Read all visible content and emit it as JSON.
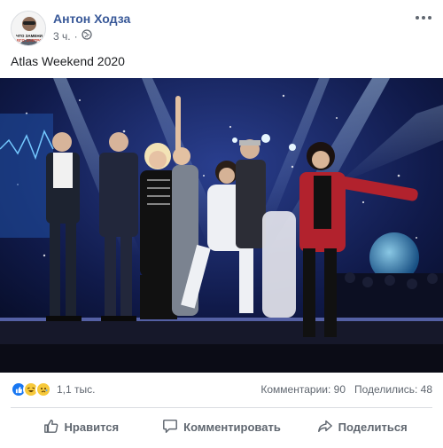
{
  "post": {
    "author": "Антон Ходза",
    "time": "3 ч.",
    "dot": "·",
    "text": "Atlas Weekend 2020",
    "icons": {
      "privacy": "globe-icon",
      "menu": "more-options-icon"
    }
  },
  "avatar": {
    "badge_line1": "ЧТО ЗАМЕНИ",
    "badge_line2": "ЕГО ЗАВТРА"
  },
  "stats": {
    "reactions": [
      "like-icon",
      "haha-icon",
      "sad-icon"
    ],
    "reaction_count": "1,1 тыс.",
    "comments": "Комментарии: 90",
    "shares": "Поделились: 48"
  },
  "actions": {
    "like": "Нравится",
    "comment": "Комментировать",
    "share": "Поделиться"
  },
  "colors": {
    "author": "#385898",
    "secondary": "#606770",
    "divider": "#dadde1"
  }
}
